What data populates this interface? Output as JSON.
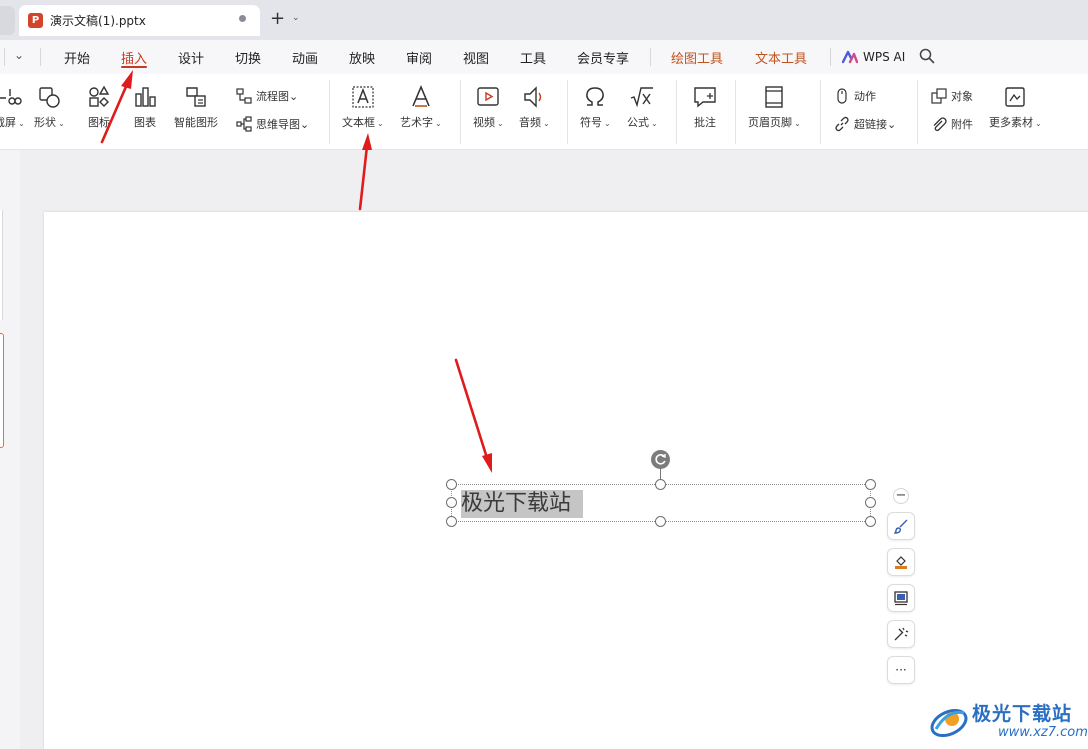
{
  "titlebar": {
    "doc_icon_letter": "P",
    "doc_title": "演示文稿(1).pptx",
    "new_tab": "+",
    "new_tab_menu": "⌄"
  },
  "menu": {
    "collapse": "⌄",
    "items": [
      "开始",
      "插入",
      "设计",
      "切换",
      "动画",
      "放映",
      "审阅",
      "视图",
      "工具",
      "会员专享",
      "绘图工具",
      "文本工具"
    ],
    "active": "插入",
    "wps_ai": "WPS AI"
  },
  "ribbon": {
    "screenshot_partial": "截屏",
    "shape": "形状",
    "icon": "图标",
    "chart": "图表",
    "smart_art": "智能图形",
    "flowchart": "流程图",
    "mindmap": "思维导图",
    "textbox": "文本框",
    "wordart": "艺术字",
    "video": "视频",
    "audio": "音频",
    "symbol": "符号",
    "formula": "公式",
    "comment": "批注",
    "header_footer": "页眉页脚",
    "action": "动作",
    "hyperlink": "超链接",
    "object": "对象",
    "attachment": "附件",
    "more_material": "更多素材",
    "caret": "⌄"
  },
  "slide": {
    "textbox_text": "极光下载站"
  },
  "float_tools": {
    "collapse": "−",
    "more": "···"
  },
  "watermark": {
    "title": "极光下载站",
    "url": "www.xz7.com"
  },
  "colors": {
    "accent": "#c63b21",
    "arrow": "#e01b1b",
    "ppt_icon": "#d4442c",
    "watermark": "#2b6fc2"
  }
}
